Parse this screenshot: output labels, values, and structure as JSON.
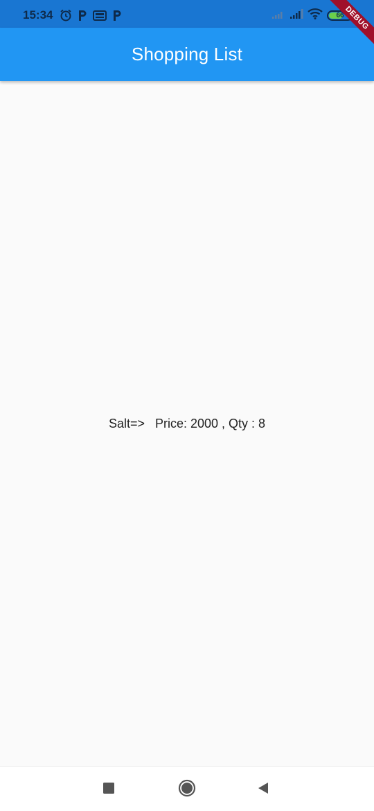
{
  "status_bar": {
    "time": "15:34",
    "battery_percent": "66",
    "battery_level": 0.66,
    "left_icons": [
      "alarm-icon",
      "p-app-icon",
      "news-app-icon",
      "p-app-icon"
    ],
    "right_icons": [
      "signal-weak-icon",
      "signal-icon",
      "wifi-icon",
      "battery-icon"
    ]
  },
  "app_bar": {
    "title": "Shopping List",
    "color": "#2196f3"
  },
  "debug_banner": {
    "label": "DEBUG"
  },
  "item": {
    "text": "Salt=>   Price: 2000 , Qty : 8"
  },
  "nav_bar": {
    "buttons": [
      "recent-apps-icon",
      "home-icon",
      "back-icon"
    ]
  }
}
